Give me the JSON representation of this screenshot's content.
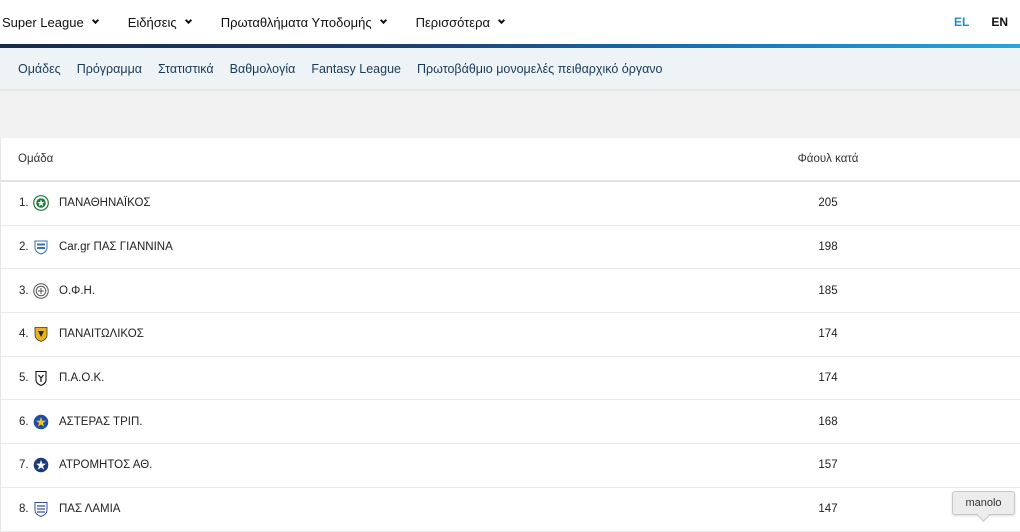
{
  "topnav": {
    "items": [
      {
        "label": "Super League"
      },
      {
        "label": "Ειδήσεις"
      },
      {
        "label": "Πρωταθλήματα Υποδομής"
      },
      {
        "label": "Περισσότερα"
      }
    ]
  },
  "lang": {
    "el": "EL",
    "en": "EN",
    "active": "EL",
    "active_color": "#1e8fc6"
  },
  "subnav": {
    "items": [
      {
        "label": "Ομάδες"
      },
      {
        "label": "Πρόγραμμα"
      },
      {
        "label": "Στατιστικά"
      },
      {
        "label": "Βαθμολογία"
      },
      {
        "label": "Fantasy League"
      },
      {
        "label": "Πρωτοβάθμιο μονομελές πειθαρχικό όργανο"
      }
    ]
  },
  "table": {
    "headers": {
      "team": "Ομάδα",
      "fouls": "Φάουλ κατά"
    },
    "rows": [
      {
        "rank": "1.",
        "team": "ΠΑΝΑΘΗΝΑΪΚΟΣ",
        "fouls": "205",
        "badge_icon": "panathinaikos-badge-icon"
      },
      {
        "rank": "2.",
        "team": "Car.gr ΠΑΣ ΓΙΑΝΝΙΝΑ",
        "fouls": "198",
        "badge_icon": "pas-giannina-badge-icon"
      },
      {
        "rank": "3.",
        "team": "Ο.Φ.Η.",
        "fouls": "185",
        "badge_icon": "ofi-badge-icon"
      },
      {
        "rank": "4.",
        "team": "ΠΑΝΑΙΤΩΛΙΚΟΣ",
        "fouls": "174",
        "badge_icon": "panetolikos-badge-icon"
      },
      {
        "rank": "5.",
        "team": "Π.Α.Ο.Κ.",
        "fouls": "174",
        "badge_icon": "paok-badge-icon"
      },
      {
        "rank": "6.",
        "team": "ΑΣΤΕΡΑΣ ΤΡΙΠ.",
        "fouls": "168",
        "badge_icon": "asteras-badge-icon"
      },
      {
        "rank": "7.",
        "team": "ΑΤΡΟΜΗΤΟΣ ΑΘ.",
        "fouls": "157",
        "badge_icon": "atromitos-badge-icon"
      },
      {
        "rank": "8.",
        "team": "ΠΑΣ ΛΑΜΙΑ",
        "fouls": "147",
        "badge_icon": "lamia-badge-icon"
      }
    ]
  },
  "tooltip": {
    "text": "manolo"
  }
}
